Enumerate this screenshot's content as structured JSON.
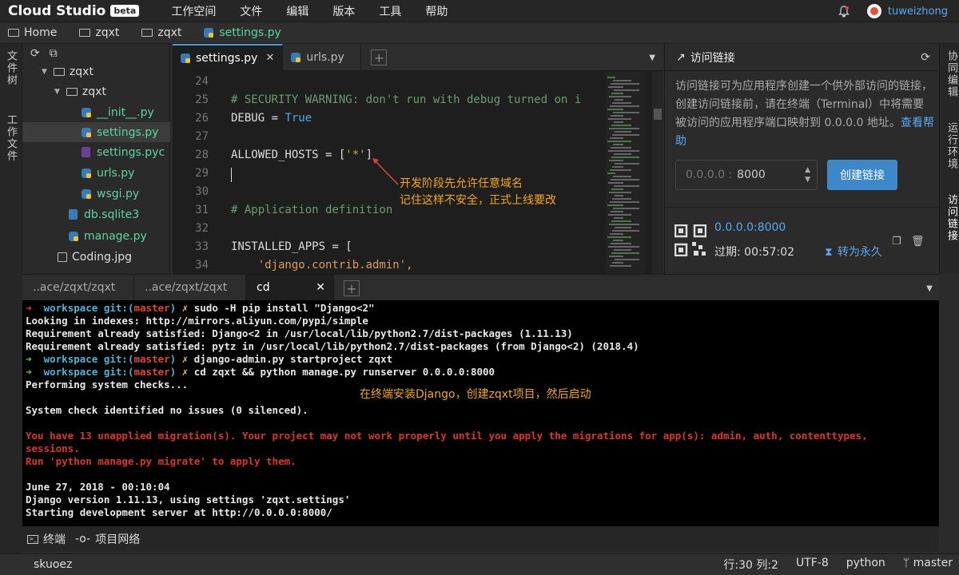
{
  "app": {
    "logo": "Cloud Studio",
    "badge": "beta"
  },
  "menu": [
    "工作空间",
    "文件",
    "编辑",
    "版本",
    "工具",
    "帮助"
  ],
  "user": {
    "name": "tuweizhong"
  },
  "breadcrumb": [
    "Home",
    "zqxt",
    "zqxt",
    "settings.py"
  ],
  "left_strip": {
    "files": "文件树",
    "workspace": "工作文件"
  },
  "right_strip": {
    "collab": "协同编辑",
    "runtime": "运行环境",
    "access": "访问链接"
  },
  "tree": [
    {
      "label": "zqxt",
      "type": "folder",
      "level": 1
    },
    {
      "label": "zqxt",
      "type": "folder",
      "level": 2
    },
    {
      "label": "__init__.py",
      "type": "py",
      "level": 3
    },
    {
      "label": "settings.py",
      "type": "py",
      "level": 3,
      "selected": true
    },
    {
      "label": "settings.pyc",
      "type": "pyc",
      "level": 3
    },
    {
      "label": "urls.py",
      "type": "py",
      "level": 3
    },
    {
      "label": "wsgi.py",
      "type": "py",
      "level": 3
    },
    {
      "label": "db.sqlite3",
      "type": "db",
      "level": 2
    },
    {
      "label": "manage.py",
      "type": "py",
      "level": 2
    },
    {
      "label": "Coding.jpg",
      "type": "img",
      "level": 1
    }
  ],
  "editor_tabs": [
    {
      "label": "settings.py",
      "active": true
    },
    {
      "label": "urls.py",
      "active": false
    }
  ],
  "code": [
    {
      "n": "24",
      "text": ""
    },
    {
      "n": "25",
      "text": "# SECURITY WARNING: don't run with debug turned on i",
      "cls": "cm"
    },
    {
      "n": "26",
      "pre": "DEBUG = ",
      "kw": "True"
    },
    {
      "n": "27",
      "text": ""
    },
    {
      "n": "28",
      "pre": "ALLOWED_HOSTS = [",
      "st": "'*'",
      "post": "]"
    },
    {
      "n": "29",
      "text": ""
    },
    {
      "n": "30",
      "text": ""
    },
    {
      "n": "31",
      "text": "# Application definition",
      "cls": "cm"
    },
    {
      "n": "32",
      "text": ""
    },
    {
      "n": "33",
      "text": "INSTALLED_APPS = ["
    },
    {
      "n": "34",
      "text": "    'django.contrib.admin',",
      "stline": true
    }
  ],
  "annotation_editor": [
    "开发阶段先允许任意域名",
    "记住这样不安全，正式上线要改"
  ],
  "access_panel": {
    "title": "访问链接",
    "desc_parts": [
      "访问链接可为应用程序创建一个供外部访问的链接，创建访问链接前，请在终端（Terminal）中将需要被访问的应用程序端口映射到 0.0.0.0 地址。",
      "查看帮助"
    ],
    "port_prefix": "0.0.0.0 :",
    "port_value": "8000",
    "create_button": "创建链接",
    "link_url": "0.0.0.0:8000",
    "expire": "过期: 00:57:02",
    "forever": "转为永久"
  },
  "terminal_tabs": [
    {
      "label": "..ace/zqxt/zqxt",
      "active": false
    },
    {
      "label": "..ace/zqxt/zqxt",
      "active": false
    },
    {
      "label": "cd",
      "active": true
    }
  ],
  "terminal": [
    {
      "prompt": "red",
      "cmd": "sudo -H pip install \"Django<2\""
    },
    {
      "text": "Looking in indexes: http://mirrors.aliyun.com/pypi/simple"
    },
    {
      "text": "Requirement already satisfied: Django<2 in /usr/local/lib/python2.7/dist-packages (1.11.13)"
    },
    {
      "text": "Requirement already satisfied: pytz in /usr/local/lib/python2.7/dist-packages (from Django<2) (2018.4)"
    },
    {
      "prompt": "green",
      "cmd": "django-admin.py startproject zqxt"
    },
    {
      "prompt": "green",
      "cmd": "cd zqxt && python manage.py runserver 0.0.0.0:8000"
    },
    {
      "text": "Performing system checks..."
    },
    {
      "text": ""
    },
    {
      "text": "System check identified no issues (0 silenced)."
    },
    {
      "text": ""
    },
    {
      "text": "You have 13 unapplied migration(s). Your project may not work properly until you apply the migrations for app(s): admin, auth, contenttypes,",
      "err": true
    },
    {
      "text": "sessions.",
      "err": true
    },
    {
      "text": "Run 'python manage.py migrate' to apply them.",
      "err": true
    },
    {
      "text": ""
    },
    {
      "text": "June 27, 2018 - 00:10:04"
    },
    {
      "text": "Django version 1.11.13, using settings 'zqxt.settings'"
    },
    {
      "text": "Starting development server at http://0.0.0.0:8000/"
    }
  ],
  "prompt": {
    "arrow_red": "➜",
    "arrow_green": "➜",
    "ws": "workspace",
    "git": "git:(",
    "branch": "master",
    "close": ")",
    "mark": "✗"
  },
  "annotation_terminal": "在终端安装Django，创建zqxt项目，然后启动",
  "bottom_tabs": [
    "终端",
    "项目网络"
  ],
  "status": {
    "left": "skuoez",
    "pos": "行:30 列:2",
    "enc": "UTF-8",
    "lang": "python",
    "branch": "master"
  }
}
